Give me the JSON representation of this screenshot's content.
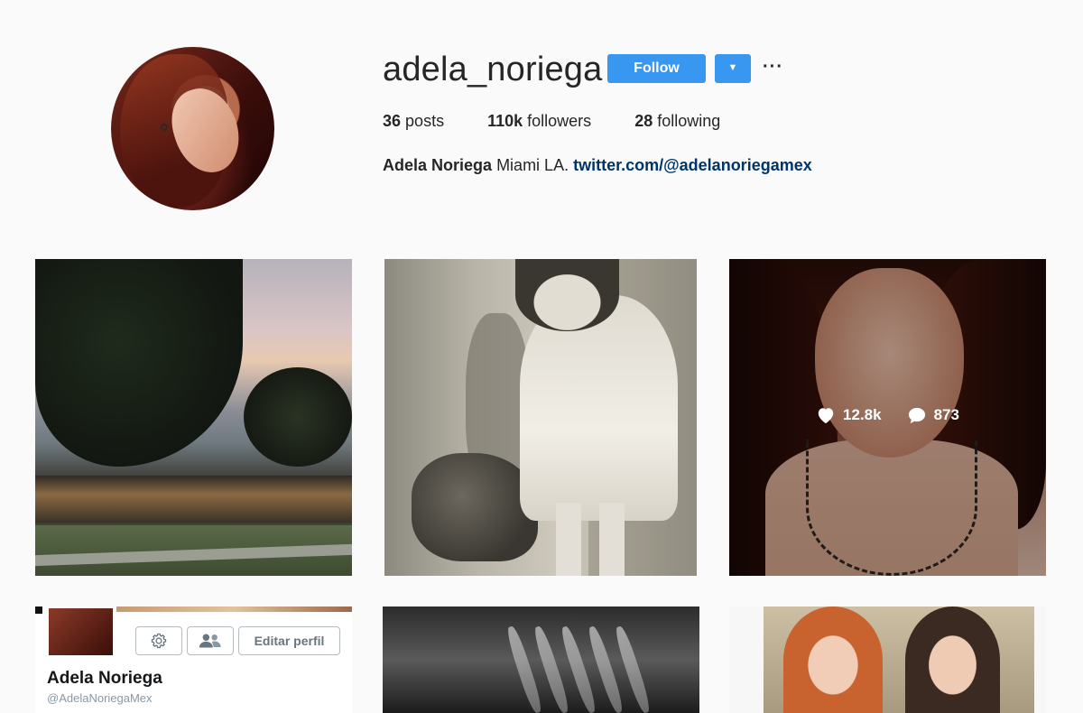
{
  "profile": {
    "username": "adela_noriega",
    "follow_label": "Follow",
    "more_label": "···"
  },
  "stats": {
    "posts_count": "36",
    "posts_label": "posts",
    "followers_count": "110k",
    "followers_label": "followers",
    "following_count": "28",
    "following_label": "following"
  },
  "bio": {
    "name": "Adela Noriega",
    "text": "Miami LA.",
    "link": "twitter.com/@adelanoriegamex"
  },
  "grid": {
    "hovered_post": {
      "likes": "12.8k",
      "comments": "873"
    },
    "twitter_card": {
      "edit_label": "Editar perfil",
      "name": "Adela Noriega",
      "handle": "@AdelaNoriegaMex"
    }
  },
  "colors": {
    "accent": "#3897f0",
    "link": "#003569",
    "background": "#fafafa"
  },
  "icons": [
    "heart-icon",
    "comment-icon",
    "gear-icon",
    "people-icon",
    "chevron-down-icon",
    "more-icon"
  ]
}
